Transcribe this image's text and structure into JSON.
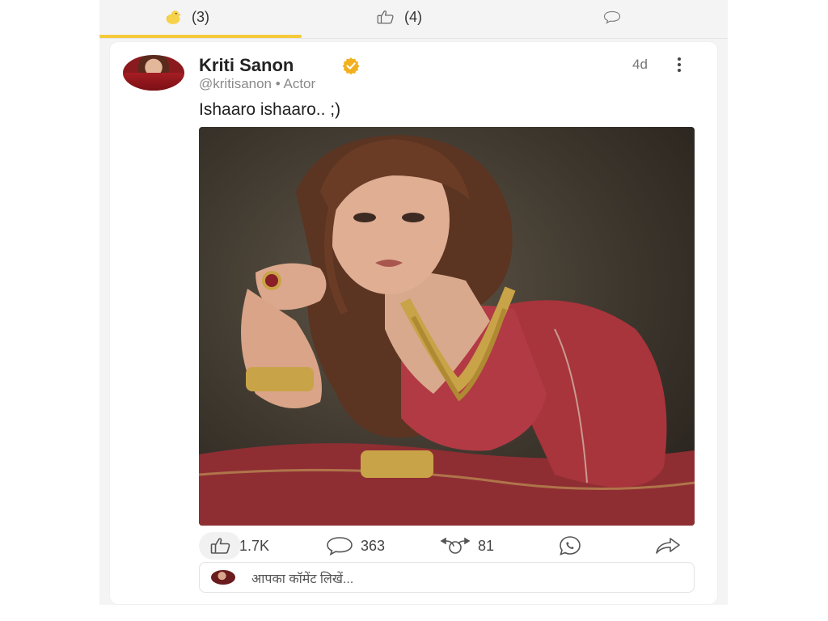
{
  "tabs": [
    {
      "icon": "chick-icon",
      "count": "(3)"
    },
    {
      "icon": "thumbs-up-icon",
      "count": "(4)"
    },
    {
      "icon": "comment-icon",
      "count": ""
    }
  ],
  "colors": {
    "accent": "#f4c93a",
    "verified": "#f2b01e"
  },
  "post": {
    "author": "Kriti Sanon",
    "handle": "@kritisanon • Actor",
    "time": "4d",
    "text": "Ishaaro ishaaro.. ;)",
    "stats": {
      "likes": "1.7K",
      "comments": "363",
      "shares": "81"
    },
    "comment_placeholder": "आपका कॉमेंट लिखें..."
  }
}
